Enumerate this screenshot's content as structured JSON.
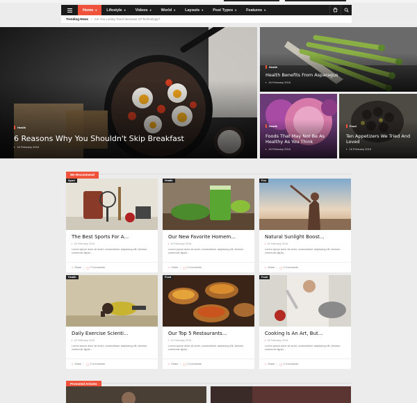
{
  "nav": {
    "items": [
      {
        "label": "Home"
      },
      {
        "label": "Lifestyle"
      },
      {
        "label": "Videos"
      },
      {
        "label": "World"
      },
      {
        "label": "Layouts"
      },
      {
        "label": "Post Types"
      },
      {
        "label": "Features"
      }
    ]
  },
  "trending": {
    "label": "Trending News",
    "text": "Are You Losing Touch Because Of Technology?"
  },
  "hero": {
    "main": {
      "category": "Health",
      "title": "6 Reasons Why You Shouldn't Skip Breakfast",
      "date": "16 February 2016"
    },
    "top_right": {
      "category": "Health",
      "title": "Health Benefits From Asparagus",
      "date": "16 February 2016"
    },
    "bottom_left": {
      "category": "Health",
      "title": "Foods That May Not Be As Healthy As You Think",
      "date": "16 February 2016"
    },
    "bottom_right": {
      "category": "Food",
      "title": "Ten Appetizers We Tried And Loved",
      "date": "16 February 2016"
    }
  },
  "recommend": {
    "label": "We Recommend"
  },
  "excerpt": "Lorem ipsum dolor sit amet, consectetuer adipiscing elit, Aenean commodo ligula...",
  "footer": {
    "share": "Share",
    "comments": "0 Comments"
  },
  "cards": [
    {
      "tag": "Sport",
      "title": "The Best Sports For A...",
      "date": "16 February 2016"
    },
    {
      "tag": "Health",
      "title": "Our New Favorite Homem...",
      "date": "16 February 2016"
    },
    {
      "tag": "Fun",
      "title": "Natural Sunlight Boost...",
      "date": "16 February 2016"
    },
    {
      "tag": "Health",
      "title": "Daily Exercise Scienti...",
      "date": "16 February 2016"
    },
    {
      "tag": "Food",
      "title": "Our Top 5 Restaurants...",
      "date": "16 February 2016"
    },
    {
      "tag": "Food",
      "title": "Cooking Is An Art, But...",
      "date": "16 February 2016"
    }
  ],
  "promoted": {
    "label": "Promoted Articles"
  },
  "colors": {
    "accent": "#f0533c",
    "nav": "#1c1c1c",
    "page": "#ececec"
  }
}
